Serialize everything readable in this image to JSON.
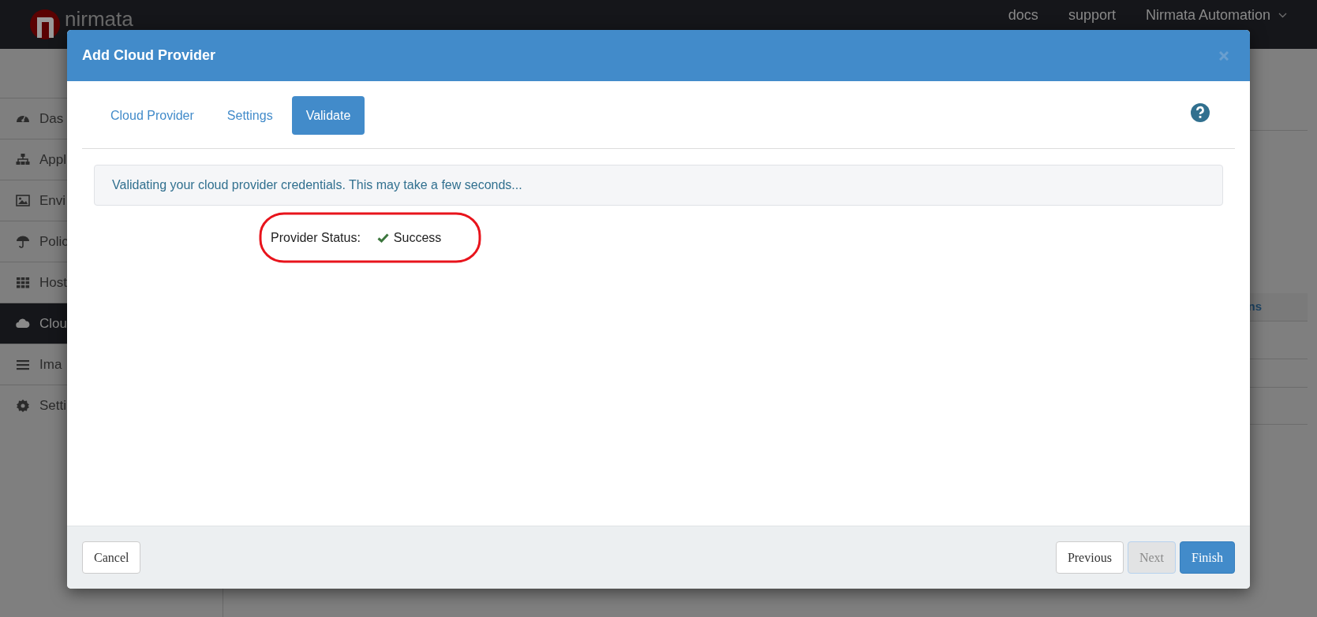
{
  "app": {
    "logo_text": "nirmata",
    "nav_links": [
      "docs",
      "support"
    ],
    "user_menu": "Nirmata Automation"
  },
  "sidebar": {
    "items": [
      {
        "label": "Das",
        "selected": false
      },
      {
        "label": "Appl",
        "selected": false
      },
      {
        "label": "Envi",
        "selected": false
      },
      {
        "label": "Polic",
        "selected": false
      },
      {
        "label": "Host",
        "selected": false
      },
      {
        "label": "Clou",
        "selected": true
      },
      {
        "label": "Ima",
        "selected": false
      },
      {
        "label": "Setti",
        "selected": false
      }
    ]
  },
  "background_table": {
    "column_heading": "ns"
  },
  "dialog": {
    "title": "Add Cloud Provider",
    "tabs": [
      {
        "label": "Cloud Provider",
        "selected": false
      },
      {
        "label": "Settings",
        "selected": false
      },
      {
        "label": "Validate",
        "selected": true
      }
    ],
    "info_message": "Validating your cloud provider credentials. This may take a few seconds...",
    "status": {
      "label": "Provider Status:",
      "value": "Success",
      "highlighted": true
    },
    "buttons": [
      {
        "label": "Cancel",
        "kind": "default",
        "disabled": false
      },
      {
        "label": "Previous",
        "kind": "default",
        "disabled": false
      },
      {
        "label": "Next",
        "kind": "default",
        "disabled": true
      },
      {
        "label": "Finish",
        "kind": "primary",
        "disabled": false
      }
    ]
  }
}
